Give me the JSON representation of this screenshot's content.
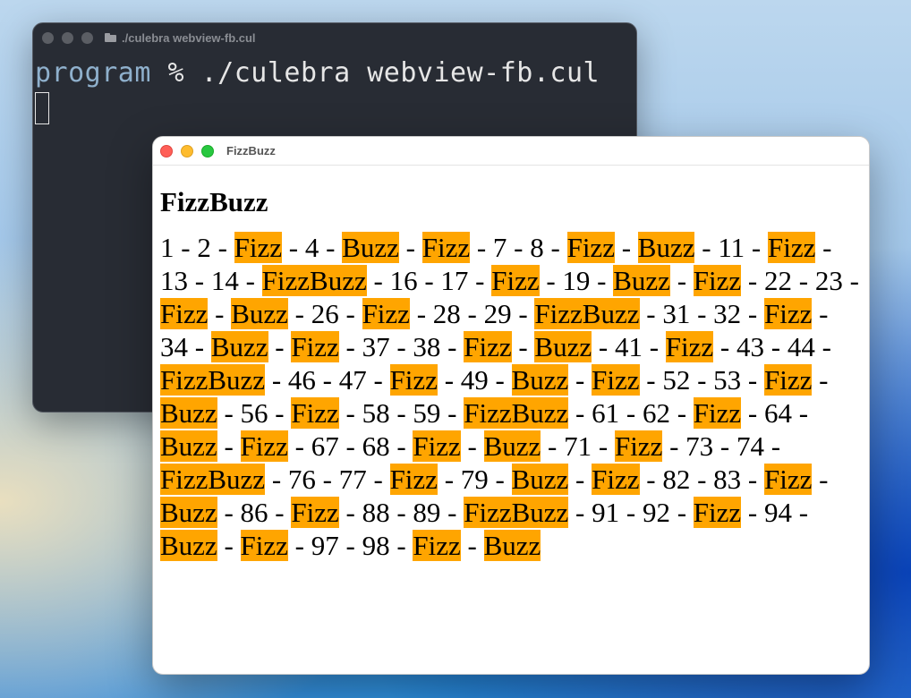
{
  "terminal": {
    "title": "./culebra webview-fb.cul",
    "prompt_dir": "program",
    "prompt_rest": " % ./culebra webview-fb.cul"
  },
  "webview": {
    "title": "FizzBuzz",
    "heading": "FizzBuzz",
    "separator": " - ",
    "items": [
      "1",
      "2",
      "Fizz",
      "4",
      "Buzz",
      "Fizz",
      "7",
      "8",
      "Fizz",
      "Buzz",
      "11",
      "Fizz",
      "13",
      "14",
      "FizzBuzz",
      "16",
      "17",
      "Fizz",
      "19",
      "Buzz",
      "Fizz",
      "22",
      "23",
      "Fizz",
      "Buzz",
      "26",
      "Fizz",
      "28",
      "29",
      "FizzBuzz",
      "31",
      "32",
      "Fizz",
      "34",
      "Buzz",
      "Fizz",
      "37",
      "38",
      "Fizz",
      "Buzz",
      "41",
      "Fizz",
      "43",
      "44",
      "FizzBuzz",
      "46",
      "47",
      "Fizz",
      "49",
      "Buzz",
      "Fizz",
      "52",
      "53",
      "Fizz",
      "Buzz",
      "56",
      "Fizz",
      "58",
      "59",
      "FizzBuzz",
      "61",
      "62",
      "Fizz",
      "64",
      "Buzz",
      "Fizz",
      "67",
      "68",
      "Fizz",
      "Buzz",
      "71",
      "Fizz",
      "73",
      "74",
      "FizzBuzz",
      "76",
      "77",
      "Fizz",
      "79",
      "Buzz",
      "Fizz",
      "82",
      "83",
      "Fizz",
      "Buzz",
      "86",
      "Fizz",
      "88",
      "89",
      "FizzBuzz",
      "91",
      "92",
      "Fizz",
      "94",
      "Buzz",
      "Fizz",
      "97",
      "98",
      "Fizz",
      "Buzz"
    ],
    "highlight_color": "#ffa500"
  }
}
